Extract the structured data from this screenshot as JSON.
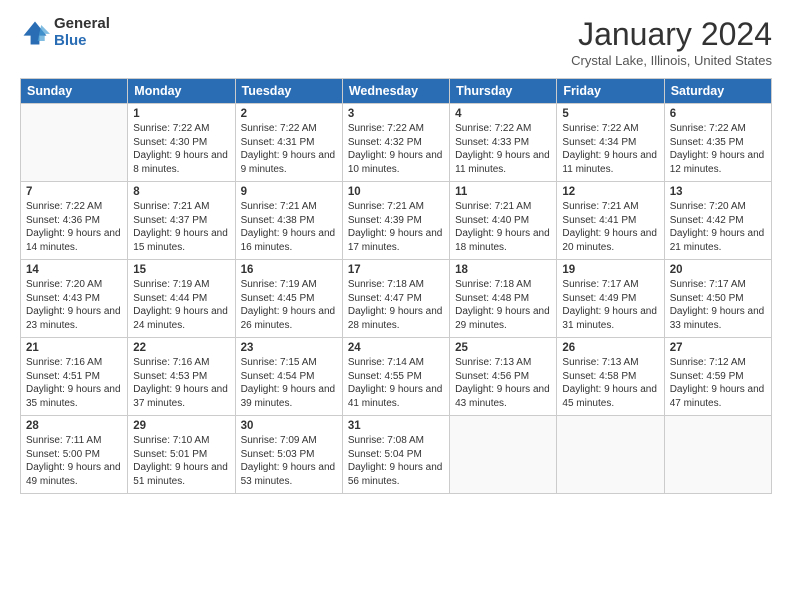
{
  "logo": {
    "general": "General",
    "blue": "Blue"
  },
  "header": {
    "title": "January 2024",
    "subtitle": "Crystal Lake, Illinois, United States"
  },
  "weekdays": [
    "Sunday",
    "Monday",
    "Tuesday",
    "Wednesday",
    "Thursday",
    "Friday",
    "Saturday"
  ],
  "weeks": [
    [
      {
        "day": "",
        "sunrise": "",
        "sunset": "",
        "daylight": ""
      },
      {
        "day": "1",
        "sunrise": "7:22 AM",
        "sunset": "4:30 PM",
        "daylight": "9 hours and 8 minutes."
      },
      {
        "day": "2",
        "sunrise": "7:22 AM",
        "sunset": "4:31 PM",
        "daylight": "9 hours and 9 minutes."
      },
      {
        "day": "3",
        "sunrise": "7:22 AM",
        "sunset": "4:32 PM",
        "daylight": "9 hours and 10 minutes."
      },
      {
        "day": "4",
        "sunrise": "7:22 AM",
        "sunset": "4:33 PM",
        "daylight": "9 hours and 11 minutes."
      },
      {
        "day": "5",
        "sunrise": "7:22 AM",
        "sunset": "4:34 PM",
        "daylight": "9 hours and 11 minutes."
      },
      {
        "day": "6",
        "sunrise": "7:22 AM",
        "sunset": "4:35 PM",
        "daylight": "9 hours and 12 minutes."
      }
    ],
    [
      {
        "day": "7",
        "sunrise": "7:22 AM",
        "sunset": "4:36 PM",
        "daylight": "9 hours and 14 minutes."
      },
      {
        "day": "8",
        "sunrise": "7:21 AM",
        "sunset": "4:37 PM",
        "daylight": "9 hours and 15 minutes."
      },
      {
        "day": "9",
        "sunrise": "7:21 AM",
        "sunset": "4:38 PM",
        "daylight": "9 hours and 16 minutes."
      },
      {
        "day": "10",
        "sunrise": "7:21 AM",
        "sunset": "4:39 PM",
        "daylight": "9 hours and 17 minutes."
      },
      {
        "day": "11",
        "sunrise": "7:21 AM",
        "sunset": "4:40 PM",
        "daylight": "9 hours and 18 minutes."
      },
      {
        "day": "12",
        "sunrise": "7:21 AM",
        "sunset": "4:41 PM",
        "daylight": "9 hours and 20 minutes."
      },
      {
        "day": "13",
        "sunrise": "7:20 AM",
        "sunset": "4:42 PM",
        "daylight": "9 hours and 21 minutes."
      }
    ],
    [
      {
        "day": "14",
        "sunrise": "7:20 AM",
        "sunset": "4:43 PM",
        "daylight": "9 hours and 23 minutes."
      },
      {
        "day": "15",
        "sunrise": "7:19 AM",
        "sunset": "4:44 PM",
        "daylight": "9 hours and 24 minutes."
      },
      {
        "day": "16",
        "sunrise": "7:19 AM",
        "sunset": "4:45 PM",
        "daylight": "9 hours and 26 minutes."
      },
      {
        "day": "17",
        "sunrise": "7:18 AM",
        "sunset": "4:47 PM",
        "daylight": "9 hours and 28 minutes."
      },
      {
        "day": "18",
        "sunrise": "7:18 AM",
        "sunset": "4:48 PM",
        "daylight": "9 hours and 29 minutes."
      },
      {
        "day": "19",
        "sunrise": "7:17 AM",
        "sunset": "4:49 PM",
        "daylight": "9 hours and 31 minutes."
      },
      {
        "day": "20",
        "sunrise": "7:17 AM",
        "sunset": "4:50 PM",
        "daylight": "9 hours and 33 minutes."
      }
    ],
    [
      {
        "day": "21",
        "sunrise": "7:16 AM",
        "sunset": "4:51 PM",
        "daylight": "9 hours and 35 minutes."
      },
      {
        "day": "22",
        "sunrise": "7:16 AM",
        "sunset": "4:53 PM",
        "daylight": "9 hours and 37 minutes."
      },
      {
        "day": "23",
        "sunrise": "7:15 AM",
        "sunset": "4:54 PM",
        "daylight": "9 hours and 39 minutes."
      },
      {
        "day": "24",
        "sunrise": "7:14 AM",
        "sunset": "4:55 PM",
        "daylight": "9 hours and 41 minutes."
      },
      {
        "day": "25",
        "sunrise": "7:13 AM",
        "sunset": "4:56 PM",
        "daylight": "9 hours and 43 minutes."
      },
      {
        "day": "26",
        "sunrise": "7:13 AM",
        "sunset": "4:58 PM",
        "daylight": "9 hours and 45 minutes."
      },
      {
        "day": "27",
        "sunrise": "7:12 AM",
        "sunset": "4:59 PM",
        "daylight": "9 hours and 47 minutes."
      }
    ],
    [
      {
        "day": "28",
        "sunrise": "7:11 AM",
        "sunset": "5:00 PM",
        "daylight": "9 hours and 49 minutes."
      },
      {
        "day": "29",
        "sunrise": "7:10 AM",
        "sunset": "5:01 PM",
        "daylight": "9 hours and 51 minutes."
      },
      {
        "day": "30",
        "sunrise": "7:09 AM",
        "sunset": "5:03 PM",
        "daylight": "9 hours and 53 minutes."
      },
      {
        "day": "31",
        "sunrise": "7:08 AM",
        "sunset": "5:04 PM",
        "daylight": "9 hours and 56 minutes."
      },
      {
        "day": "",
        "sunrise": "",
        "sunset": "",
        "daylight": ""
      },
      {
        "day": "",
        "sunrise": "",
        "sunset": "",
        "daylight": ""
      },
      {
        "day": "",
        "sunrise": "",
        "sunset": "",
        "daylight": ""
      }
    ]
  ],
  "labels": {
    "sunrise": "Sunrise:",
    "sunset": "Sunset:",
    "daylight": "Daylight:"
  }
}
